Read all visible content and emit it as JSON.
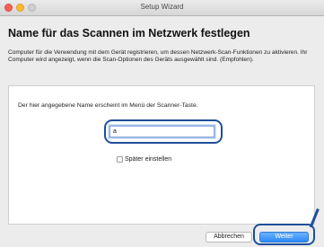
{
  "window": {
    "title": "Setup Wizard"
  },
  "page": {
    "title": "Name für das Scannen im Netzwerk festlegen",
    "description": "Computer für die Verwendung mit dem Gerät registrieren, um dessen Netzwerk-Scan-Funktionen zu aktivieren. Ihr Computer wird angezeigt, wenn die Scan-Optionen des Geräts ausgewählt sind. (Empfohlen)."
  },
  "panel": {
    "instruction": "Der hier angegebene Name erscheint im Menü der Scanner-Taste.",
    "name_value": "a",
    "later_checkbox_label": "Später einstellen",
    "later_checked": false
  },
  "buttons": {
    "cancel_label": "Abbrechen",
    "next_label": "Weiter"
  },
  "colors": {
    "primary_button": "#2d8bf6",
    "highlight_outline": "#1e4f99"
  }
}
